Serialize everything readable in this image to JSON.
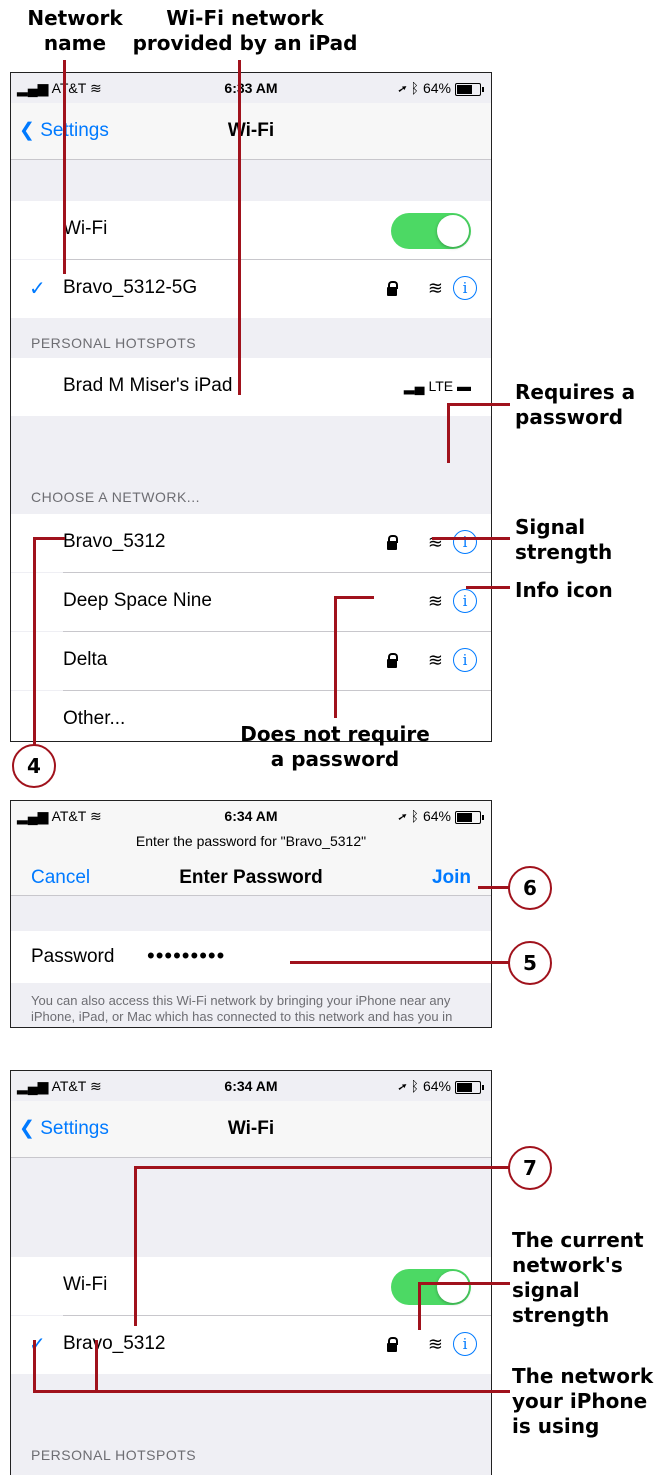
{
  "callouts": {
    "network_name": "Network\nname",
    "ipad_network": "Wi-Fi network\nprovided by an iPad",
    "requires_password": "Requires a\npassword",
    "signal_strength": "Signal\nstrength",
    "info_icon": "Info icon",
    "no_password": "Does not require\na password",
    "current_signal": "The current\nnetwork's\nsignal\nstrength",
    "network_using": "The network\nyour iPhone\nis using"
  },
  "steps": [
    "4",
    "5",
    "6",
    "7"
  ],
  "screen1": {
    "status": {
      "carrier": "AT&T",
      "time": "6:33 AM",
      "battery": "64%"
    },
    "back_label": "Settings",
    "title": "Wi-Fi",
    "wifi_label": "Wi-Fi",
    "connected": "Bravo_5312-5G",
    "hotspots_header": "PERSONAL HOTSPOTS",
    "hotspot_name": "Brad M Miser's iPad",
    "hotspot_net": "LTE",
    "choose_header": "CHOOSE A NETWORK...",
    "networks": [
      "Bravo_5312",
      "Deep Space Nine",
      "Delta",
      "Other..."
    ]
  },
  "screen2": {
    "status": {
      "carrier": "AT&T",
      "time": "6:34 AM",
      "battery": "64%"
    },
    "prompt": "Enter the password for \"Bravo_5312\"",
    "cancel": "Cancel",
    "title": "Enter Password",
    "join": "Join",
    "password_label": "Password",
    "password_value": "•••••••••",
    "footer": "You can also access this Wi-Fi network by bringing your iPhone near any iPhone, iPad, or Mac which has connected to this network and has you in their contacts."
  },
  "screen3": {
    "status": {
      "carrier": "AT&T",
      "time": "6:34 AM",
      "battery": "64%"
    },
    "back_label": "Settings",
    "title": "Wi-Fi",
    "wifi_label": "Wi-Fi",
    "connected": "Bravo_5312",
    "hotspots_header": "PERSONAL HOTSPOTS"
  },
  "colors": {
    "accent": "#007aff",
    "toggle_on": "#4cd964",
    "callout_line": "#a0121c"
  },
  "icons": [
    "signal-bars-icon",
    "wifi-icon",
    "location-arrow-icon",
    "bluetooth-icon",
    "battery-icon",
    "chevron-left-icon",
    "checkmark-icon",
    "lock-icon",
    "info-icon"
  ]
}
